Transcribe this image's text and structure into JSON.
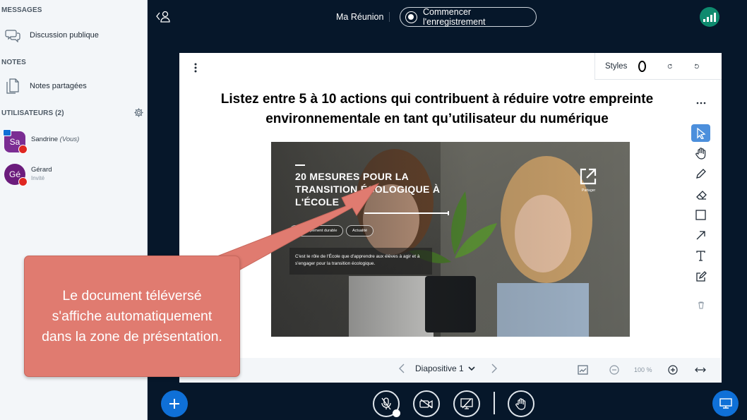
{
  "sidebar": {
    "messages_title": "MESSAGES",
    "public_chat": "Discussion publique",
    "notes_title": "NOTES",
    "shared_notes": "Notes partagées",
    "users_title": "UTILISATEURS (2)",
    "users": [
      {
        "initials": "Sa",
        "name": "Sandrine",
        "suffix": "(Vous)",
        "role": "",
        "color": "#7b2d93"
      },
      {
        "initials": "Gé",
        "name": "Gérard",
        "suffix": "",
        "role": "Invité",
        "color": "#6b1c7c"
      }
    ]
  },
  "topbar": {
    "meeting_title": "Ma Réunion",
    "record_label": "Commencer l'enregistrement"
  },
  "presentation": {
    "styles_label": "Styles",
    "slide_title": "Listez entre 5 à 10 actions qui contribuent à réduire votre empreinte environnementale en tant qu’utilisateur du numérique",
    "image": {
      "title": "20 MESURES POUR LA TRANSITION ÉCOLOGIQUE À L'ÉCOLE",
      "pill1": "Développement durable",
      "pill2": "Actualité",
      "description": "C'est le rôle de l'École que d'apprendre aux élèves à agir et à s'engager pour la transition écologique.",
      "share_label": "Partager"
    },
    "slide_label": "Diapositive 1",
    "zoom": "100 %"
  },
  "callout": {
    "text": "Le document téléversé s'affiche automatiquement dans la zone de présentation."
  },
  "colors": {
    "accent": "#0f70d7",
    "background": "#06172a",
    "callout": "#e07b70",
    "connection": "#0e8a6e"
  }
}
